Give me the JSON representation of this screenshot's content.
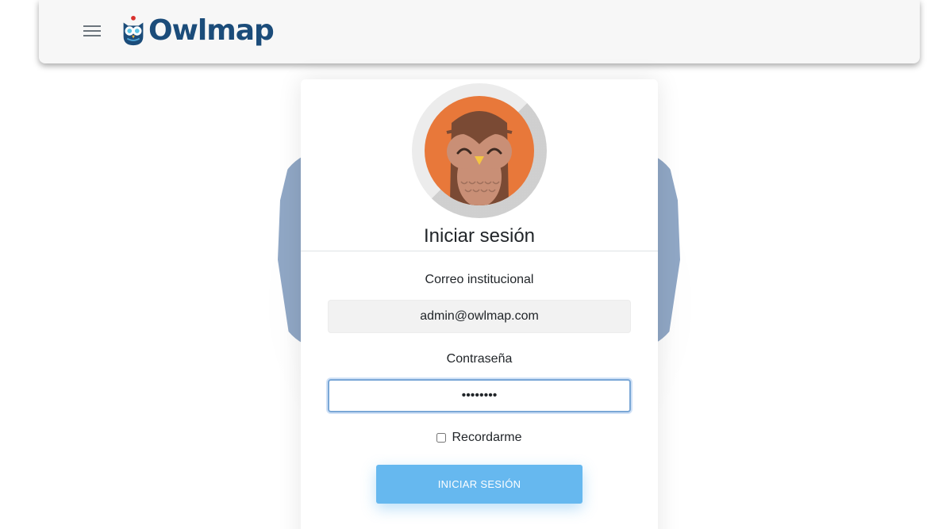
{
  "brand": {
    "name": "Owlmap",
    "color": "#1b4c7a"
  },
  "navbar": {
    "menu_icon": "hamburger-icon"
  },
  "login": {
    "title": "Iniciar sesión",
    "email_label": "Correo institucional",
    "email_value": "admin@owlmap.com",
    "password_label": "Contraseña",
    "password_value": "••••••••",
    "remember_label": "Recordarme",
    "remember_checked": false,
    "submit_label": "INICIAR SESIÓN"
  },
  "colors": {
    "accent": "#66b8ef",
    "focus_border": "#7aa7d6",
    "avatar_orange": "#e8783a"
  }
}
